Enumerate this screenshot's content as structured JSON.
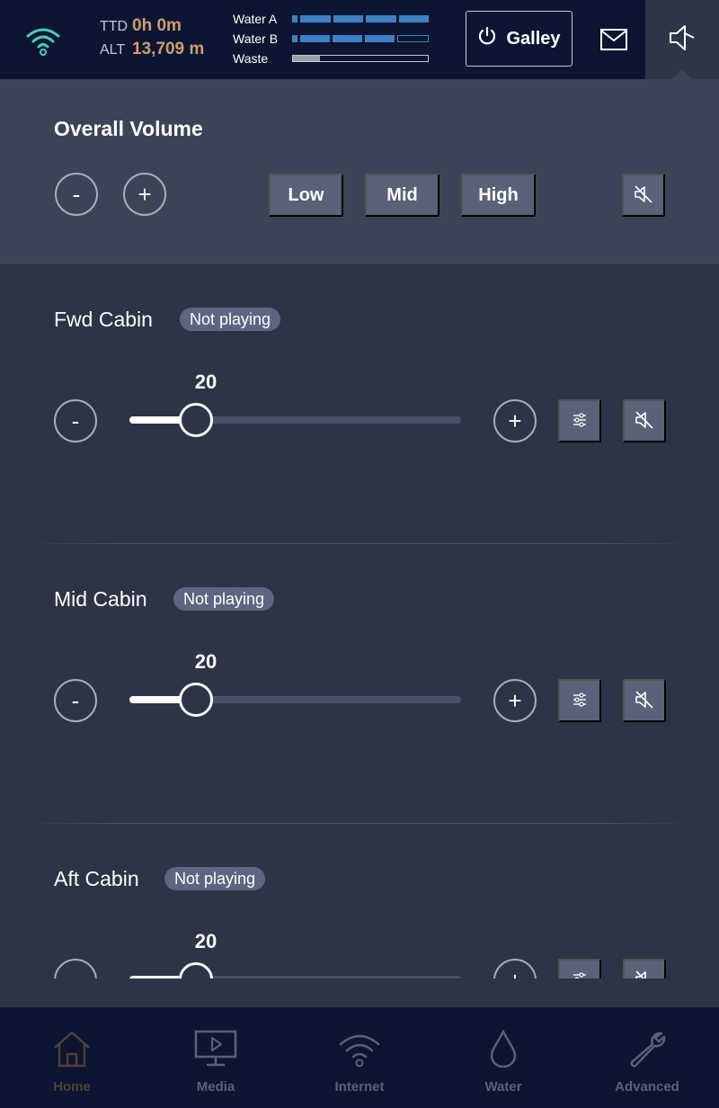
{
  "header": {
    "ttd_label": "TTD",
    "ttd_value": "0h 0m",
    "alt_label": "ALT",
    "alt_value": "13,709 m",
    "tanks": [
      {
        "label": "Water A",
        "level": 1.0
      },
      {
        "label": "Water B",
        "level": 0.75
      },
      {
        "label": "Waste",
        "level": 0.2
      }
    ],
    "galley_label": "Galley"
  },
  "overall": {
    "title": "Overall Volume",
    "minus_label": "-",
    "plus_label": "+",
    "presets": [
      "Low",
      "Mid",
      "High"
    ]
  },
  "zones": [
    {
      "name": "Fwd Cabin",
      "status": "Not playing",
      "volume": "20",
      "level": 20
    },
    {
      "name": "Mid Cabin",
      "status": "Not playing",
      "volume": "20",
      "level": 20
    },
    {
      "name": "Aft Cabin",
      "status": "Not playing",
      "volume": "20",
      "level": 20
    }
  ],
  "nav": [
    {
      "label": "Home",
      "icon": "home-icon"
    },
    {
      "label": "Media",
      "icon": "media-icon"
    },
    {
      "label": "Internet",
      "icon": "wifi-icon"
    },
    {
      "label": "Water",
      "icon": "water-drop-icon"
    },
    {
      "label": "Advanced",
      "icon": "wrench-icon"
    }
  ],
  "colors": {
    "accent_teal": "#3fd1b8",
    "stat_gold": "#c9a06a",
    "tank_blue": "#3b82c4",
    "header_bg": "#0e1532",
    "panel_bg": "#2e3347"
  }
}
